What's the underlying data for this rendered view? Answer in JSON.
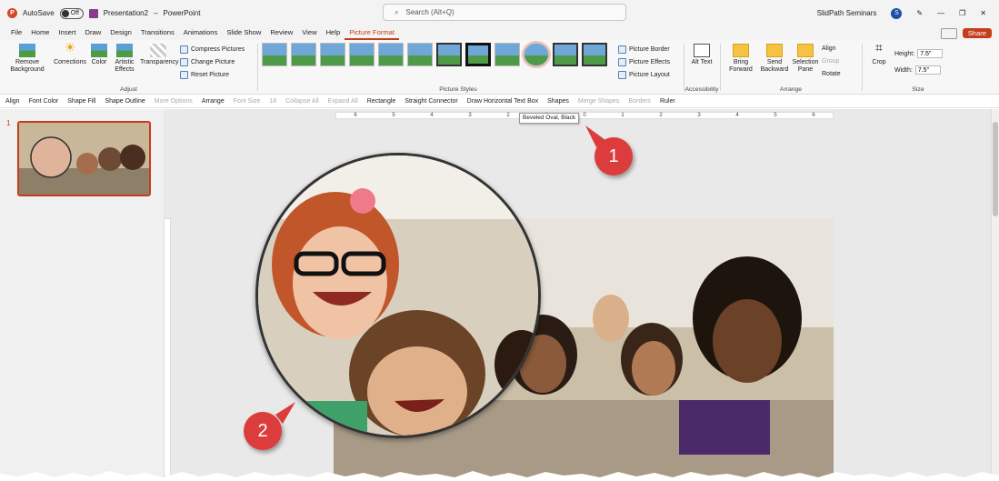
{
  "titlebar": {
    "autosave_label": "AutoSave",
    "autosave_state": "Off",
    "file_name": "Presentation2",
    "app_name": "PowerPoint",
    "search_placeholder": "Search (Alt+Q)",
    "account_name": "SlidPath Seminars",
    "account_initial": "S"
  },
  "tabs": [
    "File",
    "Home",
    "Insert",
    "Draw",
    "Design",
    "Transitions",
    "Animations",
    "Slide Show",
    "Review",
    "View",
    "Help",
    "Picture Format"
  ],
  "active_tab": "Picture Format",
  "share_label": "Share",
  "ribbon": {
    "adjust": {
      "label": "Adjust",
      "remove_background": "Remove Background",
      "corrections": "Corrections",
      "color": "Color",
      "artistic_effects": "Artistic Effects",
      "transparency": "Transparency",
      "compress": "Compress Pictures",
      "change": "Change Picture",
      "reset": "Reset Picture"
    },
    "picture_styles": {
      "label": "Picture Styles",
      "border": "Picture Border",
      "effects": "Picture Effects",
      "layout": "Picture Layout"
    },
    "accessibility": {
      "label": "Accessibility",
      "alt_text": "Alt Text"
    },
    "arrange": {
      "label": "Arrange",
      "bring_forward": "Bring Forward",
      "send_backward": "Send Backward",
      "selection_pane": "Selection Pane",
      "align": "Align",
      "group": "Group",
      "rotate": "Rotate"
    },
    "size": {
      "label": "Size",
      "crop": "Crop",
      "height_label": "Height:",
      "height_value": "7.5\"",
      "width_label": "Width:",
      "width_value": "7.5\""
    }
  },
  "drawing_toolbar": {
    "align": "Align",
    "font_color": "Font Color",
    "shape_fill": "Shape Fill",
    "shape_outline": "Shape Outline",
    "more_options": "More Options",
    "arrange": "Arrange",
    "font_size": "Font Size",
    "font_size_value": "18",
    "collapse_all": "Collapse All",
    "expand_all": "Expand All",
    "rectangle": "Rectangle",
    "straight_connector": "Straight Connector",
    "text_box": "Draw Horizontal Text Box",
    "shapes": "Shapes",
    "merge_shapes": "Merge Shapes",
    "borders": "Borders",
    "ruler": "Ruler"
  },
  "slides_pane": {
    "slide_number": "1"
  },
  "tooltip": "Beveled Oval, Black",
  "ruler_ticks": [
    "6",
    "5",
    "4",
    "3",
    "2",
    "1",
    "0",
    "1",
    "2",
    "3",
    "4",
    "5",
    "6"
  ],
  "callouts": [
    "1",
    "2"
  ],
  "colors": {
    "accent": "#c43e1c",
    "callout": "#dc3c3c"
  }
}
